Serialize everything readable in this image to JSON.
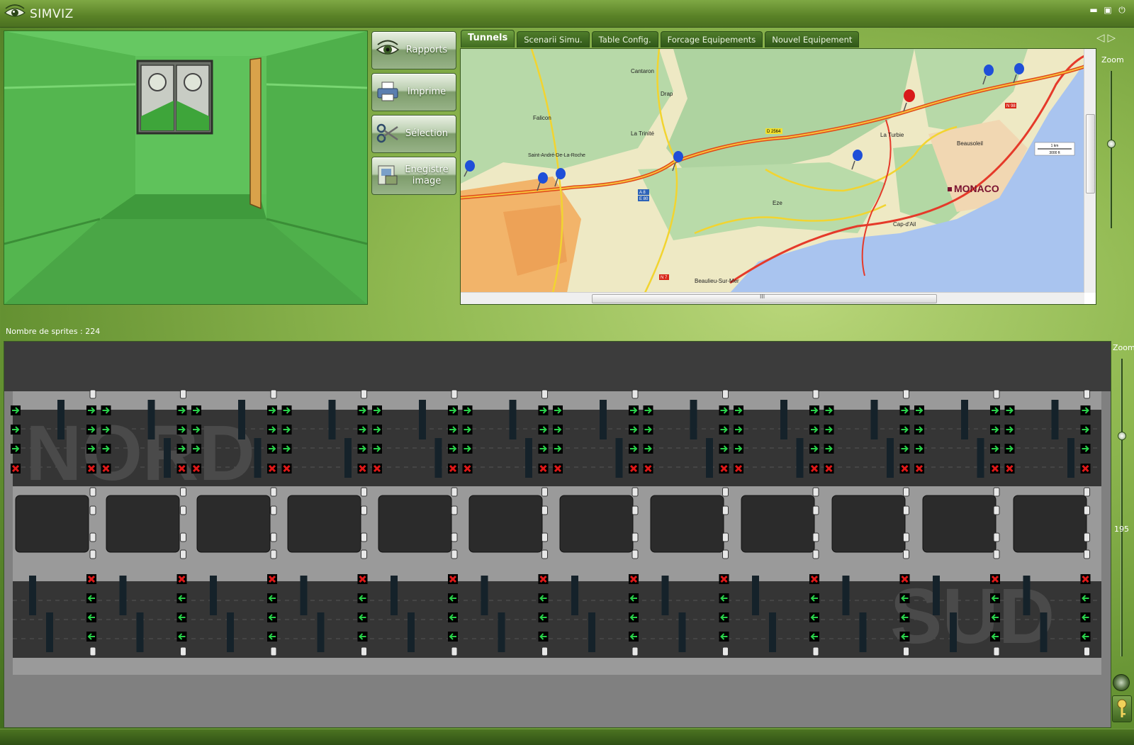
{
  "app": {
    "title": "SIMVIZ",
    "window_controls": [
      "minimize",
      "maximize",
      "power"
    ]
  },
  "side_buttons": [
    {
      "label": "Rapports",
      "icon": "eye-icon"
    },
    {
      "label": "Imprime",
      "icon": "printer-icon"
    },
    {
      "label": "Sélection",
      "icon": "scissors-icon"
    },
    {
      "label": "Enegistre image",
      "icon": "save-image-icon"
    }
  ],
  "tabs": [
    {
      "label": "Tunnels",
      "active": true
    },
    {
      "label": "Scenarii Simu.",
      "active": false
    },
    {
      "label": "Table Config.",
      "active": false
    },
    {
      "label": "Forcage Equipements",
      "active": false
    },
    {
      "label": "Nouvel Equipement",
      "active": false
    }
  ],
  "map": {
    "place_labels": [
      "Cantaron",
      "Drap",
      "La Trinité",
      "Saint-André-De-La-Roche",
      "Falicon",
      "La Turbie",
      "Beausoleil",
      "MONACO",
      "Eze",
      "Beaulieu-Sur-Mer",
      "Cap-d'Ail"
    ],
    "road_labels": [
      "A 8",
      "E 80",
      "D 2564",
      "N 98",
      "N 7"
    ],
    "scale_bar": [
      "1 km",
      "3000 ft"
    ],
    "markers": [
      {
        "color": "blue"
      },
      {
        "color": "blue"
      },
      {
        "color": "blue"
      },
      {
        "color": "blue"
      },
      {
        "color": "blue"
      },
      {
        "color": "blue"
      },
      {
        "color": "blue"
      },
      {
        "color": "red"
      }
    ],
    "scroll_grip": "III"
  },
  "map_zoom": {
    "label": "Zoom"
  },
  "tunnel_view": {
    "sprite_count_label": "Nombre de sprites : 224",
    "zoom_label": "Zoom",
    "zoom_value": "195",
    "watermark_north": "NORD",
    "watermark_south": "SUD"
  },
  "colors": {
    "background_green": "#8fb850",
    "accent_dark_green": "#3f6a1f",
    "asphalt": "#3a3a3a",
    "signal_green": "#29d24a",
    "signal_red": "#e01818",
    "marker_blue": "#1f4fd8",
    "marker_red": "#d81a1a"
  }
}
